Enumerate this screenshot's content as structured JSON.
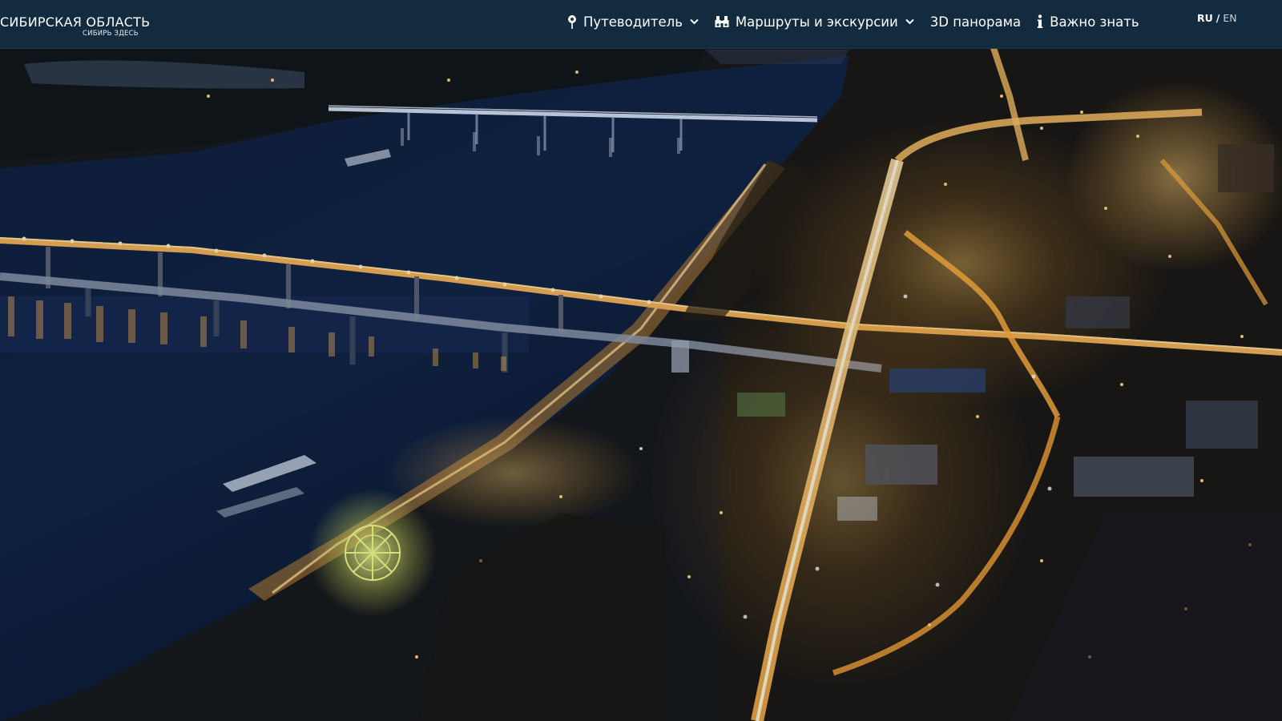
{
  "header": {
    "logo": {
      "title": "СИБИРСКАЯ ОБЛАСТЬ",
      "subtitle": "СИБИРЬ ЗДЕСЬ"
    },
    "nav": [
      {
        "label": "Путеводитель",
        "icon": "map-pin-icon",
        "has_dropdown": true
      },
      {
        "label": "Маршруты и экскурсии",
        "icon": "binoculars-icon",
        "has_dropdown": true
      },
      {
        "label": "3D панорама",
        "icon": null,
        "has_dropdown": false
      },
      {
        "label": "Важно знать",
        "icon": "info-icon",
        "has_dropdown": false
      }
    ],
    "languages": {
      "active": "RU",
      "separator": "/",
      "other": "EN"
    }
  },
  "hero": {
    "scene": "night-city-aerial-river-bridges"
  },
  "colors": {
    "header_bg": "#142e42",
    "river": "#0e1e3a",
    "city_light": "#f5a623",
    "text": "#ffffff"
  }
}
